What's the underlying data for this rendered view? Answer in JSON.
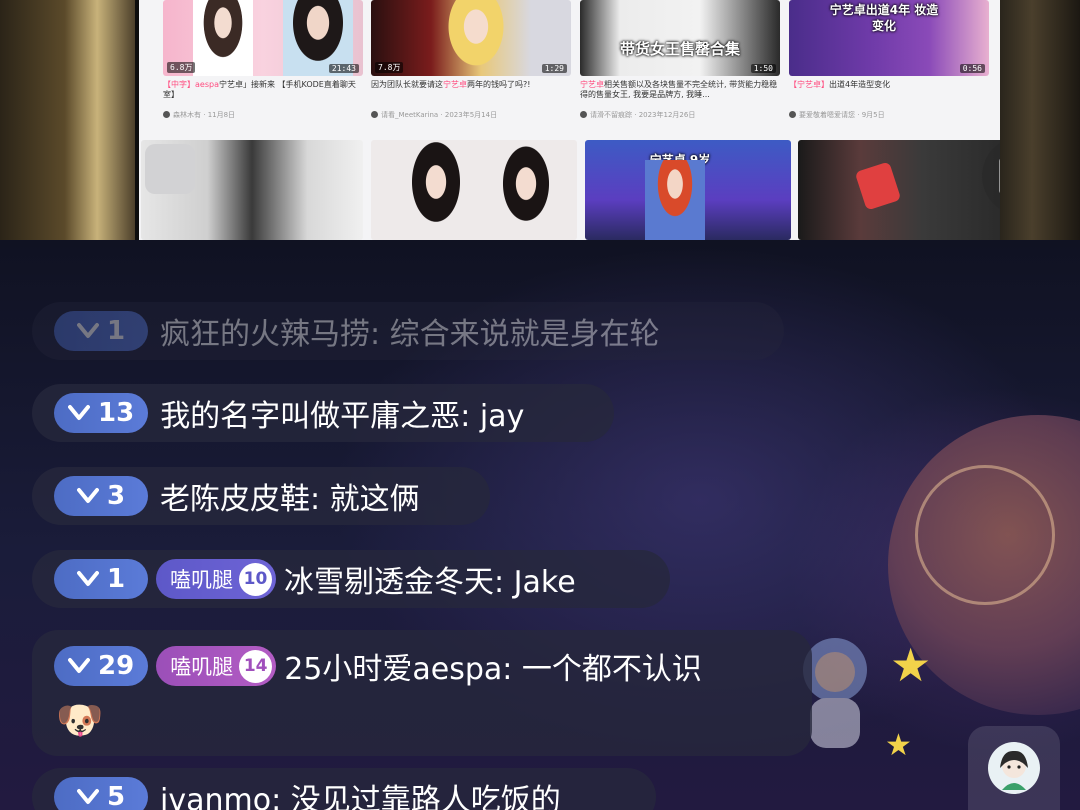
{
  "tablet": {
    "videos": [
      {
        "title_hl": "【中字】aespa",
        "title_rest": "宁艺卓」接新来 【手机KODE直着聊天室】",
        "author": "森林木有",
        "date": "11月8日",
        "views": "6.8万",
        "duration": "21:43"
      },
      {
        "title_pre": "因为团队长就要请这",
        "title_hl": "宁艺卓",
        "title_rest": "两年的钱吗了吗?!",
        "author": "请看_MeetKarina",
        "date": "2023年5月14日",
        "views": "7.8万",
        "duration": "1:29"
      },
      {
        "title_hl": "宁艺卓",
        "title_rest": "相关售额以及各块售量不完全统计, 带货能力稳稳得的售量女王, 我要是品牌方, 我睡...",
        "author": "请滑不留痕踪",
        "date": "2023年12月26日",
        "overlay": "带货女王售罄合集",
        "duration": "1:50"
      },
      {
        "title_hl": "【宁艺卓】",
        "title_rest": "出道4年造型变化",
        "author": "要爱敬着嗯爱请您",
        "date": "9月5日",
        "overlay": "宁艺卓出道4年 妆造变化",
        "duration": "0:56"
      },
      {
        "overlay": "宁艺卓 9岁"
      }
    ]
  },
  "chat": {
    "messages": [
      {
        "level": "1",
        "username": "疯狂的火辣马捞",
        "sep": ": ",
        "content": "综合来说就是身在轮"
      },
      {
        "level": "13",
        "username": "我的名字叫做平庸之恶",
        "sep": ": ",
        "content": "jay"
      },
      {
        "level": "3",
        "username": "老陈皮皮鞋",
        "sep": ": ",
        "content": "就这俩"
      },
      {
        "level": "1",
        "fan_name": "嗑叽腿",
        "fan_level": "10",
        "username": "冰雪剔透金冬天",
        "sep": ": ",
        "content": "Jake"
      },
      {
        "level": "29",
        "fan_name": "嗑叽腿",
        "fan_level": "14",
        "username": "25小时爱aespa",
        "sep": ": ",
        "content": "一个都不认识",
        "emoji": "🐶"
      },
      {
        "level": "5",
        "username": "ivanmo",
        "sep": ": ",
        "content": "没见过靠路人吃饭的"
      }
    ]
  },
  "colors": {
    "level_badge": "#5b7bd8",
    "fan_blue": "#6e64d6",
    "fan_purple": "#b35cc4",
    "title_highlight": "#ff4d80"
  },
  "icons": [
    "rotate-screen-icon",
    "level-chevron-icon",
    "star-icon",
    "user-avatar-icon"
  ]
}
